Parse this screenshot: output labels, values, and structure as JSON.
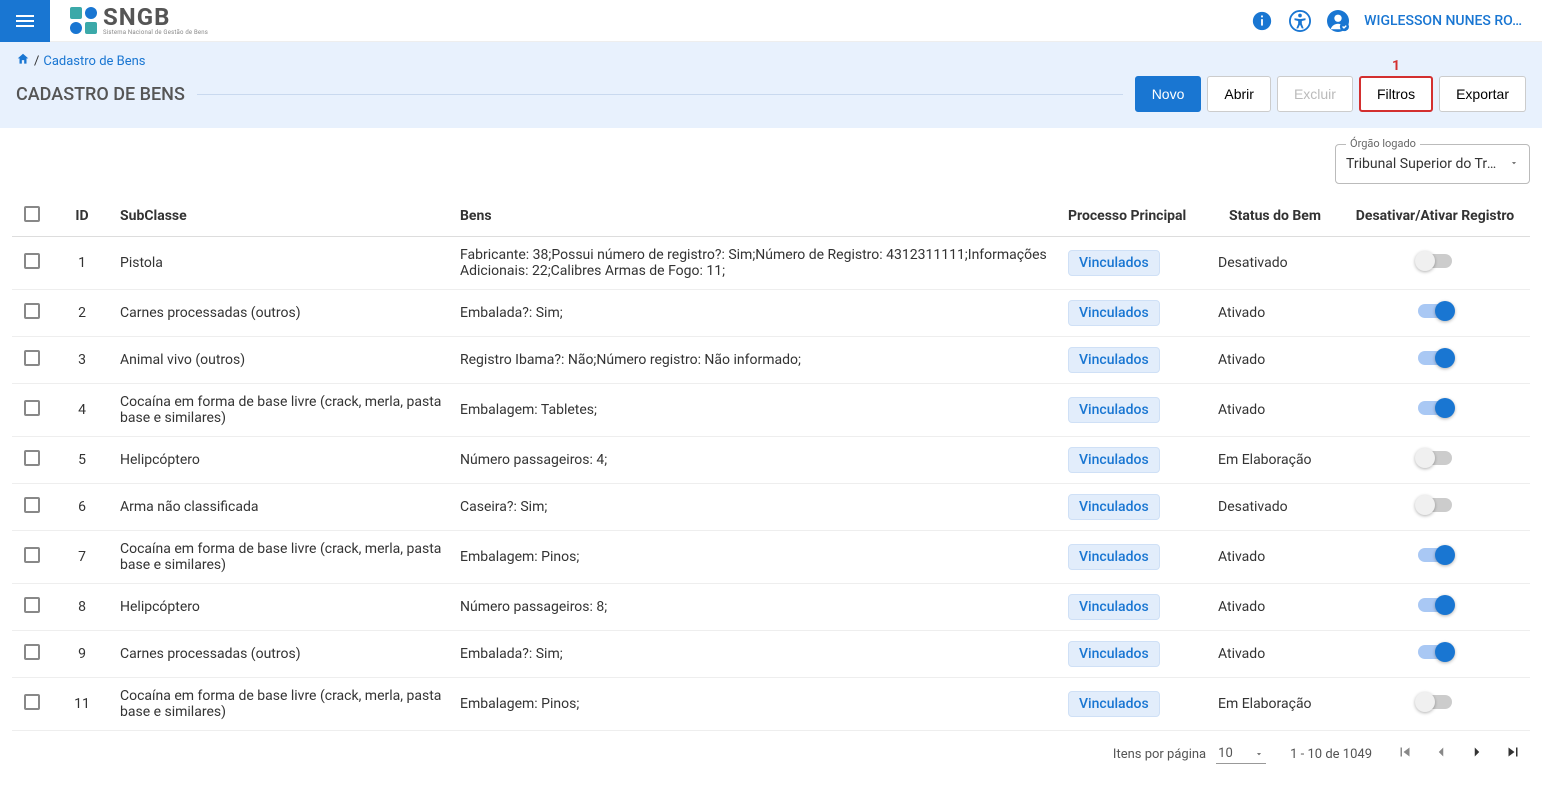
{
  "app": {
    "name": "SNGB",
    "subtitle": "Sistema Nacional de Gestão de Bens"
  },
  "user": {
    "name": "WIGLESSON NUNES RO…"
  },
  "breadcrumb": {
    "current": "Cadastro de Bens"
  },
  "page": {
    "title": "CADASTRO DE BENS"
  },
  "actions": {
    "novo": "Novo",
    "abrir": "Abrir",
    "excluir": "Excluir",
    "filtros": "Filtros",
    "exportar": "Exportar"
  },
  "annotation": {
    "filtros_number": "1"
  },
  "orgao": {
    "label": "Órgão logado",
    "value": "Tribunal Superior do Tra…"
  },
  "table": {
    "headers": {
      "id": "ID",
      "subclasse": "SubClasse",
      "bens": "Bens",
      "processo": "Processo Principal",
      "status": "Status do Bem",
      "toggle": "Desativar/Ativar Registro"
    },
    "chip_label": "Vinculados",
    "rows": [
      {
        "id": "1",
        "subclasse": "Pistola",
        "bens": "Fabricante: 38;Possui número de registro?: Sim;Número de Registro: 4312311111;Informações Adicionais: 22;Calibres Armas de Fogo: 11;",
        "status": "Desativado",
        "active": false
      },
      {
        "id": "2",
        "subclasse": "Carnes processadas (outros)",
        "bens": "Embalada?: Sim;",
        "status": "Ativado",
        "active": true
      },
      {
        "id": "3",
        "subclasse": "Animal vivo (outros)",
        "bens": "Registro Ibama?: Não;Número registro: Não informado;",
        "status": "Ativado",
        "active": true
      },
      {
        "id": "4",
        "subclasse": "Cocaína em forma de base livre (crack, merla, pasta base e similares)",
        "bens": "Embalagem: Tabletes;",
        "status": "Ativado",
        "active": true
      },
      {
        "id": "5",
        "subclasse": "Helipcóptero",
        "bens": "Número passageiros: 4;",
        "status": "Em Elaboração",
        "active": false
      },
      {
        "id": "6",
        "subclasse": "Arma não classificada",
        "bens": "Caseira?: Sim;",
        "status": "Desativado",
        "active": false
      },
      {
        "id": "7",
        "subclasse": "Cocaína em forma de base livre (crack, merla, pasta base e similares)",
        "bens": "Embalagem: Pinos;",
        "status": "Ativado",
        "active": true
      },
      {
        "id": "8",
        "subclasse": "Helipcóptero",
        "bens": "Número passageiros: 8;",
        "status": "Ativado",
        "active": true
      },
      {
        "id": "9",
        "subclasse": "Carnes processadas (outros)",
        "bens": "Embalada?: Sim;",
        "status": "Ativado",
        "active": true
      },
      {
        "id": "11",
        "subclasse": "Cocaína em forma de base livre (crack, merla, pasta base e similares)",
        "bens": "Embalagem: Pinos;",
        "status": "Em Elaboração",
        "active": false
      }
    ]
  },
  "paginator": {
    "items_per_page_label": "Itens por página",
    "page_size": "10",
    "range": "1 - 10 de 1049"
  }
}
